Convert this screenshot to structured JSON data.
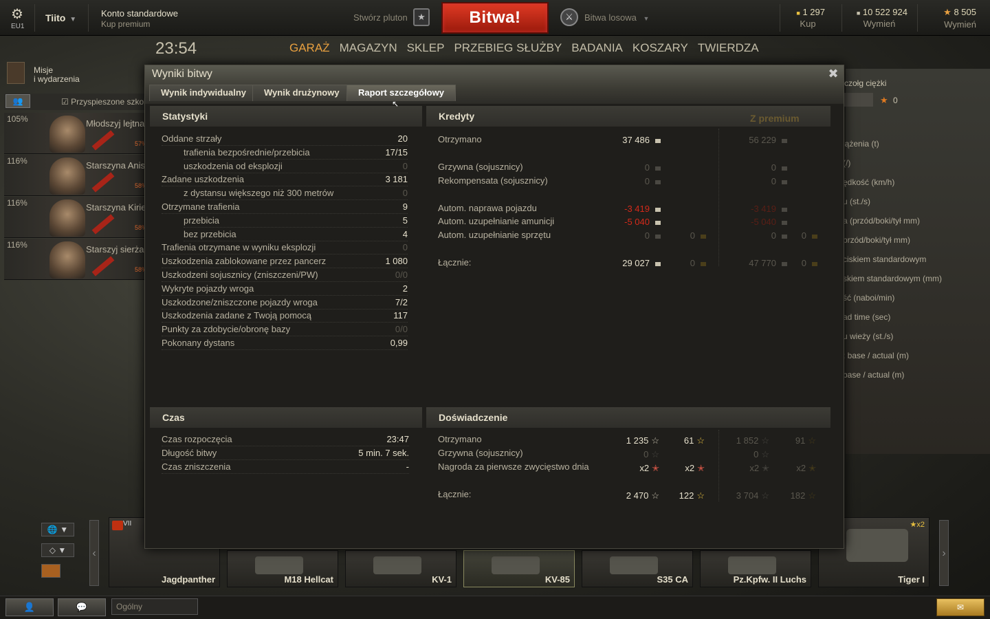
{
  "topbar": {
    "server": "EU1",
    "username": "Tiito",
    "account_type": "Konto standardowe",
    "buy_premium": "Kup premium",
    "create_platoon": "Stwórz pluton",
    "battle_button": "Bitwa!",
    "battle_mode": "Bitwa losowa",
    "gold": {
      "value": "1 297",
      "action": "Kup"
    },
    "credits": {
      "value": "10 522 924",
      "action": "Wymień"
    },
    "free_xp": {
      "value": "8 505",
      "action": "Wymień"
    }
  },
  "clock": "23:54",
  "nav": [
    "GARAŻ",
    "MAGAZYN",
    "SKLEP",
    "PRZEBIEG SŁUŻBY",
    "BADANIA",
    "KOSZARY",
    "TWIERDZA"
  ],
  "missions": {
    "line1": "Misje",
    "line2": "i wydarzenia"
  },
  "accelerated_training": "Przyspieszone szkolenie",
  "crew": [
    {
      "pct": "105%",
      "name": "Młodszyj lejtnant",
      "skill": "57%"
    },
    {
      "pct": "116%",
      "name": "Starszyna Anisimov",
      "skill": "58%"
    },
    {
      "pct": "116%",
      "name": "Starszyna Kiriejev",
      "skill": "58%"
    },
    {
      "pct": "116%",
      "name": "Starszyj sierżant",
      "skill": "58%"
    }
  ],
  "right_panel": {
    "title": "czołg ciężki",
    "xp": "0",
    "rows": [
      "iążenia (t)",
      "(/)",
      "ędkość (km/h)",
      "u (st./s)",
      "a (przód/boki/tył mm)",
      "przód/boki/tył mm)",
      "ciskiem standardowym",
      "skiem standardowym (mm)",
      "ść (naboi/min)",
      "ad time (sec)",
      "u wieży (st./s)",
      ": base / actual (m)",
      "base / actual (m)"
    ]
  },
  "dialog": {
    "title": "Wyniki bitwy",
    "tabs": [
      "Wynik indywidualny",
      "Wynik drużynowy",
      "Raport szczegółowy"
    ],
    "stats": {
      "header": "Statystyki",
      "rows": [
        {
          "label": "Oddane strzały",
          "value": "20",
          "indent": false,
          "dim": false
        },
        {
          "label": "trafienia bezpośrednie/przebicia",
          "value": "17/15",
          "indent": true,
          "dim": false
        },
        {
          "label": "uszkodzenia od eksplozji",
          "value": "0",
          "indent": true,
          "dim": true
        },
        {
          "label": "Zadane uszkodzenia",
          "value": "3 181",
          "indent": false,
          "dim": false
        },
        {
          "label": "z dystansu większego niż 300 metrów",
          "value": "0",
          "indent": true,
          "dim": true
        },
        {
          "label": "Otrzymane trafienia",
          "value": "9",
          "indent": false,
          "dim": false
        },
        {
          "label": "przebicia",
          "value": "5",
          "indent": true,
          "dim": false
        },
        {
          "label": "bez przebicia",
          "value": "4",
          "indent": true,
          "dim": false
        },
        {
          "label": "Trafienia otrzymane w wyniku eksplozji",
          "value": "0",
          "indent": false,
          "dim": true
        },
        {
          "label": "Uszkodzenia zablokowane przez pancerz",
          "value": "1 080",
          "indent": false,
          "dim": false
        },
        {
          "label": "Uszkodzeni sojusznicy (zniszczeni/PW)",
          "value": "0/0",
          "indent": false,
          "dim": true
        },
        {
          "label": "Wykryte pojazdy wroga",
          "value": "2",
          "indent": false,
          "dim": false
        },
        {
          "label": "Uszkodzone/zniszczone pojazdy wroga",
          "value": "7/2",
          "indent": false,
          "dim": false
        },
        {
          "label": "Uszkodzenia zadane z Twoją pomocą",
          "value": "117",
          "indent": false,
          "dim": false
        },
        {
          "label": "Punkty za zdobycie/obronę bazy",
          "value": "0/0",
          "indent": false,
          "dim": true
        },
        {
          "label": "Pokonany dystans",
          "value": "0,99",
          "indent": false,
          "dim": false
        }
      ]
    },
    "credits": {
      "header": "Kredyty",
      "premium_header": "Z premium",
      "received": {
        "label": "Otrzymano",
        "std": "37 486",
        "prem": "56 229"
      },
      "fine": {
        "label": "Grzywna (sojusznicy)",
        "std": "0",
        "prem": "0"
      },
      "comp": {
        "label": "Rekompensata (sojusznicy)",
        "std": "0",
        "prem": "0"
      },
      "repair": {
        "label": "Autom. naprawa pojazdu",
        "std": "-3 419",
        "prem": "-3 419"
      },
      "ammo": {
        "label": "Autom. uzupełnianie amunicji",
        "std": "-5 040",
        "prem": "-5 040"
      },
      "equip": {
        "label": "Autom. uzupełnianie sprzętu",
        "std": "0",
        "std_gold": "0",
        "prem": "0",
        "prem_gold": "0"
      },
      "total": {
        "label": "Łącznie:",
        "std": "29 027",
        "std_gold": "0",
        "prem": "47 770",
        "prem_gold": "0"
      }
    },
    "time": {
      "header": "Czas",
      "rows": [
        {
          "label": "Czas rozpoczęcia",
          "value": "23:47"
        },
        {
          "label": "Długość bitwy",
          "value": "5 min. 7 sek."
        },
        {
          "label": "Czas zniszczenia",
          "value": "-"
        }
      ]
    },
    "xp": {
      "header": "Doświadczenie",
      "received": {
        "label": "Otrzymano",
        "xp": "1 235",
        "free": "61",
        "prem_xp": "1 852",
        "prem_free": "91"
      },
      "fine": {
        "label": "Grzywna (sojusznicy)",
        "xp": "0",
        "prem_xp": "0"
      },
      "first_win": {
        "label": "Nagroda za pierwsze zwycięstwo dnia",
        "xp": "x2",
        "free": "x2",
        "prem_xp": "x2",
        "prem_free": "x2"
      },
      "total": {
        "label": "Łącznie:",
        "xp": "2 470",
        "free": "122",
        "prem_xp": "3 704",
        "prem_free": "182"
      }
    }
  },
  "carousel": {
    "first": {
      "name": "Jagdpanther",
      "tier": "VII"
    },
    "tanks": [
      "M18 Hellcat",
      "KV-1",
      "KV-85",
      "S35 CA",
      "Pz.Kpfw. II Luchs"
    ],
    "last": {
      "name": "Tiger I",
      "bonus": "x2"
    }
  },
  "chat": {
    "channel": "Ogólny"
  },
  "colors": {
    "accent": "#e8a040",
    "battle": "#c0281a",
    "negative": "#d42a1a"
  }
}
